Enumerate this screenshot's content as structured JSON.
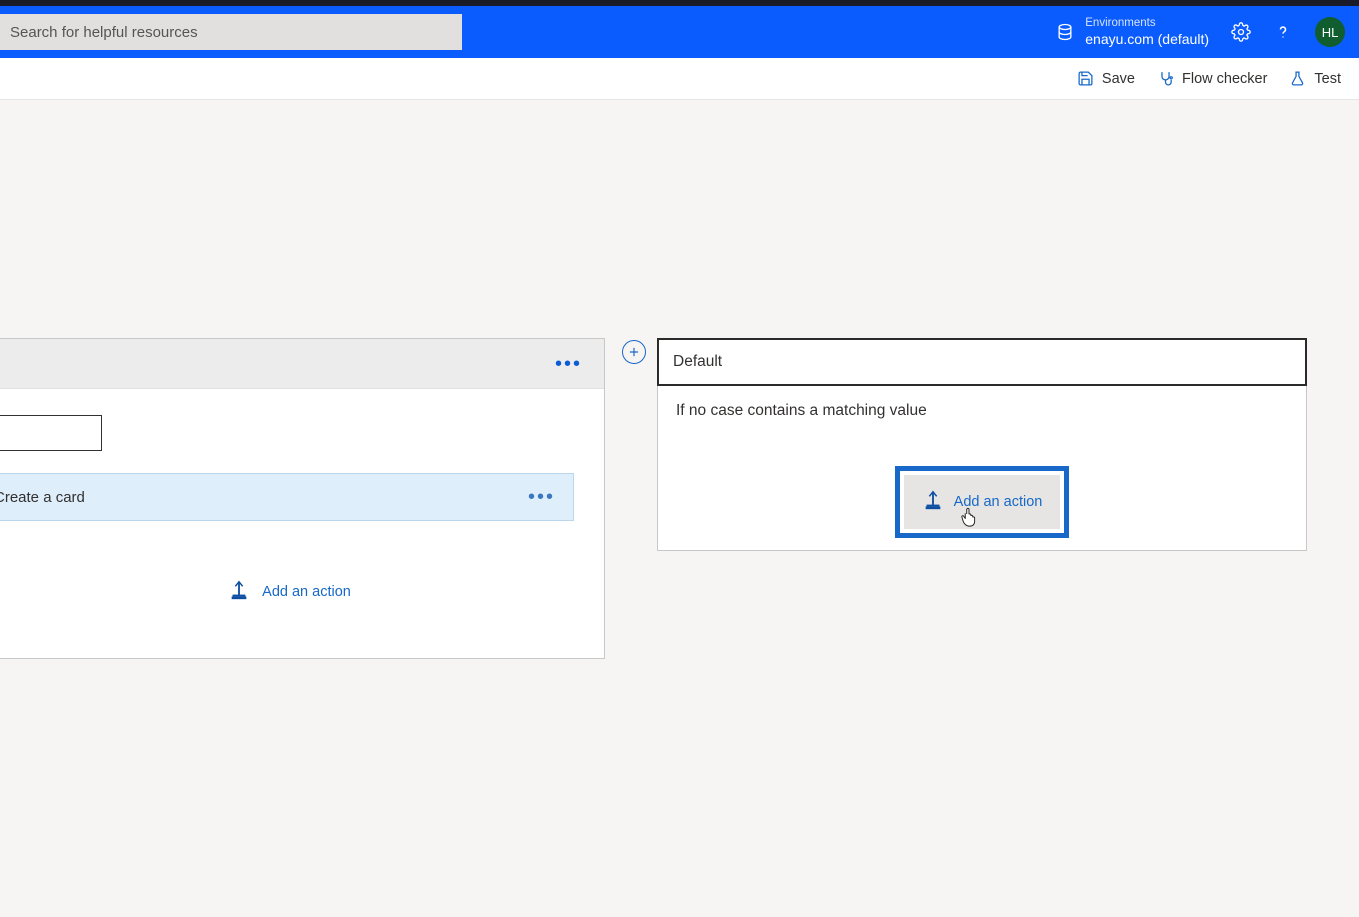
{
  "header": {
    "search_placeholder": "Search for helpful resources",
    "env_label": "Environments",
    "env_value": "enayu.com (default)",
    "avatar_initials": "HL"
  },
  "toolbar": {
    "save": "Save",
    "flow_checker": "Flow checker",
    "test": "Test"
  },
  "case_card": {
    "action_label": "Create a card",
    "add_action": "Add an action"
  },
  "default_card": {
    "title": "Default",
    "desc": "If no case contains a matching value",
    "add_action": "Add an action"
  }
}
